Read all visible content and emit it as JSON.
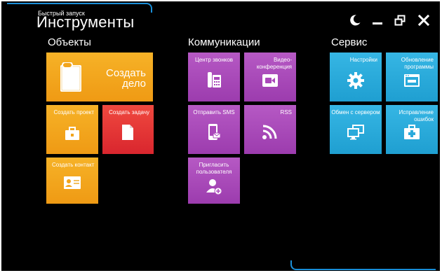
{
  "window": {
    "subtitle": "Быстрый запуск",
    "title": "Инструменты",
    "accent_color": "#1a8fd8",
    "controls": [
      "moon-icon",
      "minimize-icon",
      "restore-icon",
      "close-icon"
    ]
  },
  "sections": {
    "objects": {
      "title": "Объекты",
      "tiles": {
        "create_case": {
          "label_line1": "Создать",
          "label_line2": "дело",
          "icon": "document-icon",
          "color": "#f2a51c"
        },
        "create_project": {
          "label": "Создать проект",
          "icon": "briefcase-icon",
          "color": "#f2a51c"
        },
        "create_task": {
          "label": "Создать задачу",
          "icon": "page-icon",
          "color": "#e5353a"
        },
        "create_contact": {
          "label": "Создать контакт",
          "icon": "contact-card-icon",
          "color": "#f2a51c"
        }
      }
    },
    "communications": {
      "title": "Коммуникации",
      "tiles": {
        "call_center": {
          "label": "Центр звонков",
          "icon": "desk-phone-icon",
          "color": "#aa48ba"
        },
        "video_conference": {
          "label_line1": "Видео-",
          "label_line2": "конференция",
          "icon": "video-camera-icon",
          "color": "#aa48ba"
        },
        "send_sms": {
          "label": "Отправить SMS",
          "icon": "mobile-sms-icon",
          "color": "#aa48ba"
        },
        "rss": {
          "label": "RSS",
          "icon": "rss-icon",
          "color": "#aa48ba"
        },
        "invite_user": {
          "label_line1": "Пригласить",
          "label_line2": "пользователя",
          "icon": "add-user-icon",
          "color": "#aa48ba"
        }
      }
    },
    "service": {
      "title": "Сервис",
      "tiles": {
        "settings": {
          "label": "Настройки",
          "icon": "gear-icon",
          "color": "#2aaadb"
        },
        "update": {
          "label_line1": "Обновление",
          "label_line2": "программы",
          "icon": "browser-update-icon",
          "color": "#2aaadb"
        },
        "sync_server": {
          "label": "Обмен с сервером",
          "icon": "monitors-sync-icon",
          "color": "#2aaadb"
        },
        "fix_errors": {
          "label_line1": "Исправление",
          "label_line2": "ошибок",
          "icon": "first-aid-kit-icon",
          "color": "#2aaadb"
        }
      }
    }
  }
}
